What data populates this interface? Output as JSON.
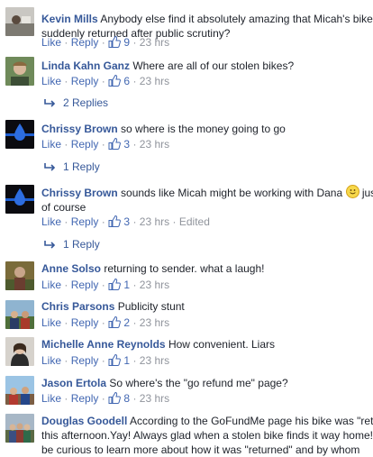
{
  "comments": [
    {
      "author": "Kevin Mills",
      "text_line1": "Anybody else find it absolutely amazing that Micah's bike",
      "text_line2": "suddenly returned after public scrutiny?",
      "like": "Like",
      "reply": "Reply",
      "likes": "9",
      "time": "23 hrs",
      "edited": ""
    },
    {
      "author": "Linda Kahn Ganz",
      "text_line1": "Where are all of our stolen bikes?",
      "like": "Like",
      "reply": "Reply",
      "likes": "6",
      "time": "23 hrs",
      "replies": "2 Replies"
    },
    {
      "author": "Chrissy Brown",
      "text_line1": "so where is the money going to go",
      "like": "Like",
      "reply": "Reply",
      "likes": "3",
      "time": "23 hrs",
      "replies": "1 Reply"
    },
    {
      "author": "Chrissy Brown",
      "text_line1": "sounds like Micah might be working with Dana",
      "text_after_emoji": " jus",
      "text_line2": "of course",
      "like": "Like",
      "reply": "Reply",
      "likes": "3",
      "time": "23 hrs",
      "edited": "Edited",
      "replies": "1 Reply"
    },
    {
      "author": "Anne Solso",
      "text_line1": "returning to sender. what a laugh!",
      "like": "Like",
      "reply": "Reply",
      "likes": "1",
      "time": "23 hrs"
    },
    {
      "author": "Chris Parsons",
      "text_line1": "Publicity stunt",
      "like": "Like",
      "reply": "Reply",
      "likes": "2",
      "time": "23 hrs"
    },
    {
      "author": "Michelle Anne Reynolds",
      "text_line1": "How convenient. Liars",
      "like": "Like",
      "reply": "Reply",
      "likes": "1",
      "time": "23 hrs"
    },
    {
      "author": "Jason Ertola",
      "text_line1": "So where's the \"go refund me\" page?",
      "like": "Like",
      "reply": "Reply",
      "likes": "8",
      "time": "23 hrs"
    },
    {
      "author": "Douglas Goodell",
      "text_line1": "According to the GoFundMe page his bike was \"ret",
      "text_line2": "this afternoon.Yay! Always glad when a stolen bike finds it way home!",
      "text_line3": "be curious to learn more about how it was \"returned\" and by whom"
    }
  ],
  "separator": "·",
  "colors": {
    "link": "#365899",
    "action": "#4267b2",
    "meta": "#90949c",
    "text": "#1d2129"
  }
}
